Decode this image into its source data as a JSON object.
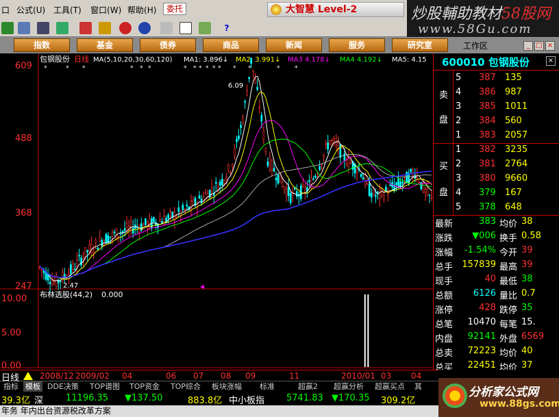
{
  "menubar": {
    "items": [
      "公式",
      "工具",
      "窗口",
      "帮助"
    ],
    "shortcuts": [
      "(U)",
      "(T)",
      "(W)",
      "(H)"
    ],
    "entrust_label": "委托",
    "partial_item": "口"
  },
  "brand": {
    "title": "大智慧 Level-2"
  },
  "watermark": {
    "line1_prefix": "炒股輔助教材",
    "line1_red": "58股网",
    "line2": "www.58Gu.com"
  },
  "nav": {
    "buttons": [
      "指数",
      "基金",
      "债券",
      "商品",
      "新闻",
      "服务",
      "研究室"
    ],
    "workarea_label": "工作区"
  },
  "chart": {
    "stock_name": "包钢股份",
    "period": "日线",
    "ma_params": "MA(5,10,20,30,60,120)",
    "ma_values": [
      {
        "label": "MA1:",
        "value": "3.896",
        "arrow": "↓",
        "color": "#ffffff"
      },
      {
        "label": "MA2:",
        "value": "3.991",
        "arrow": "↓",
        "color": "#ffff00"
      },
      {
        "label": "MA3",
        "value": "4.178",
        "arrow": "↓",
        "color": "#ff00ff"
      },
      {
        "label": "MA4",
        "value": "4.192",
        "arrow": "↓",
        "color": "#00ff00"
      },
      {
        "label": "MA5:",
        "value": "4.15",
        "arrow": "",
        "color": "#ffffff"
      }
    ],
    "y_ticks": [
      "609",
      "488",
      "368",
      "247"
    ],
    "high_label": "6.09",
    "low_label": "2.47",
    "indicator_name": "布林选股(44,2)",
    "indicator_value": "0.000",
    "indicator_ticks": [
      "10.00",
      "5.00",
      "0.00"
    ],
    "period_label": "日线",
    "x_ticks": [
      "2008/12",
      "2009/02",
      "04",
      "06",
      "07",
      "08",
      "09",
      "11",
      "2010/01",
      "03",
      "04"
    ]
  },
  "chart_data": {
    "type": "candlestick",
    "title": "包钢股份 日线",
    "ylim": [
      2.47,
      6.09
    ],
    "y_ticks": [
      6.09,
      4.88,
      3.68,
      2.47
    ],
    "x_ticks": [
      "2008/12",
      "2009/02",
      "04",
      "06",
      "07",
      "08",
      "09",
      "11",
      "2010/01",
      "03",
      "04"
    ],
    "price_path": [
      [
        0,
        2.75
      ],
      [
        4,
        2.5
      ],
      [
        8,
        2.7
      ],
      [
        12,
        3.0
      ],
      [
        16,
        3.2
      ],
      [
        20,
        3.3
      ],
      [
        24,
        3.4
      ],
      [
        28,
        3.45
      ],
      [
        33,
        3.55
      ],
      [
        38,
        3.7
      ],
      [
        42,
        3.9
      ],
      [
        46,
        4.1
      ],
      [
        49,
        4.4
      ],
      [
        52,
        5.2
      ],
      [
        54,
        6.09
      ],
      [
        56,
        5.4
      ],
      [
        58,
        4.5
      ],
      [
        60,
        4.3
      ],
      [
        62,
        4.1
      ],
      [
        64,
        3.9
      ],
      [
        66,
        3.95
      ],
      [
        68,
        4.0
      ],
      [
        70,
        4.2
      ],
      [
        72,
        4.5
      ],
      [
        74,
        4.8
      ],
      [
        76,
        4.7
      ],
      [
        78,
        4.5
      ],
      [
        80,
        4.4
      ],
      [
        82,
        4.3
      ],
      [
        84,
        4.0
      ],
      [
        86,
        3.9
      ],
      [
        88,
        3.95
      ],
      [
        90,
        4.05
      ],
      [
        92,
        4.1
      ],
      [
        94,
        4.2
      ],
      [
        96,
        4.3
      ],
      [
        98,
        4.0
      ],
      [
        100,
        3.83
      ]
    ],
    "ma_lines": [
      {
        "name": "MA1",
        "color": "#ffffff",
        "current": 3.896
      },
      {
        "name": "MA2",
        "color": "#ffff00",
        "current": 3.991
      },
      {
        "name": "MA3",
        "color": "#ff00ff",
        "current": 4.178
      },
      {
        "name": "MA4",
        "color": "#00ff00",
        "current": 4.192
      },
      {
        "name": "MA5",
        "color": "#ffffff",
        "current": 4.15
      }
    ],
    "indicator": {
      "name": "布林选股(44,2)",
      "ylim": [
        0,
        10
      ],
      "spikes": [
        {
          "x_frac": 0.83,
          "value": 10
        },
        {
          "x_frac": 0.838,
          "value": 10
        }
      ]
    }
  },
  "quote": {
    "code": "600010",
    "name": "包钢股份",
    "sell_label_1": "卖",
    "sell_label_2": "盘",
    "buy_label_1": "买",
    "buy_label_2": "盘",
    "sell": [
      {
        "level": "5",
        "price": "387",
        "volume": "135"
      },
      {
        "level": "4",
        "price": "386",
        "volume": "987"
      },
      {
        "level": "3",
        "price": "385",
        "volume": "1011"
      },
      {
        "level": "2",
        "price": "384",
        "volume": "560"
      },
      {
        "level": "1",
        "price": "383",
        "volume": "2057"
      }
    ],
    "buy": [
      {
        "level": "1",
        "price": "382",
        "volume": "3235"
      },
      {
        "level": "2",
        "price": "381",
        "volume": "2764"
      },
      {
        "level": "3",
        "price": "380",
        "volume": "9660"
      },
      {
        "level": "4",
        "price": "379",
        "volume": "167"
      },
      {
        "level": "5",
        "price": "378",
        "volume": "648"
      }
    ],
    "stats": [
      {
        "l1": "最新",
        "v1": "383",
        "c1": "#00ff00",
        "l2": "均价",
        "v2": "38",
        "c2": "#ffff00"
      },
      {
        "l1": "涨跌",
        "v1": "▼006",
        "c1": "#00ff00",
        "l2": "换手",
        "v2": "0.58",
        "c2": "#ffff00"
      },
      {
        "l1": "涨幅",
        "v1": "-1.54%",
        "c1": "#00ff00",
        "l2": "今开",
        "v2": "39",
        "c2": "#ff3030"
      },
      {
        "l1": "总手",
        "v1": "157839",
        "c1": "#ffff00",
        "l2": "最高",
        "v2": "39",
        "c2": "#ff3030"
      },
      {
        "l1": "现手",
        "v1": "40",
        "c1": "#ff3030",
        "l2": "最低",
        "v2": "38",
        "c2": "#00ff00"
      },
      {
        "l1": "总额",
        "v1": "6126",
        "c1": "#00ffff",
        "l2": "量比",
        "v2": "0.7",
        "c2": "#ffff00"
      },
      {
        "l1": "涨停",
        "v1": "428",
        "c1": "#ff3030",
        "l2": "跌停",
        "v2": "35",
        "c2": "#00ff00"
      },
      {
        "l1": "总笔",
        "v1": "10470",
        "c1": "#ffffff",
        "l2": "每笔",
        "v2": "15.",
        "c2": "#ffffff"
      },
      {
        "l1": "内盘",
        "v1": "92141",
        "c1": "#00ff00",
        "l2": "外盘",
        "v2": "6569",
        "c2": "#ff3030"
      },
      {
        "l1": "总卖",
        "v1": "72223",
        "c1": "#ffff00",
        "l2": "均价",
        "v2": "40",
        "c2": "#ffff00"
      },
      {
        "l1": "总买",
        "v1": "22451",
        "c1": "#ffff00",
        "l2": "均价",
        "v2": "37",
        "c2": "#ffff00"
      }
    ]
  },
  "tabs": [
    "指标",
    "模板",
    "DDE决策",
    "TOP谱图",
    "TOP资金",
    "TOP综合",
    "板块涨幅",
    "标准",
    "超赢2",
    "超赢分析",
    "超赢买点",
    "其"
  ],
  "ticker": {
    "seg1": "39.3亿",
    "seg1_label": "深",
    "seg2_index": "11196.35",
    "seg2_change": "▼137.50",
    "seg3": "883.8亿",
    "seg3_label": "中小板指",
    "seg4_index": "5741.83",
    "seg4_change": "▼170.35",
    "seg5": "309.2亿"
  },
  "news": {
    "text": "年务 年内出台资源税改革方案"
  },
  "logo2": {
    "title": "分析家公式网",
    "url": "www.88gs.com"
  }
}
